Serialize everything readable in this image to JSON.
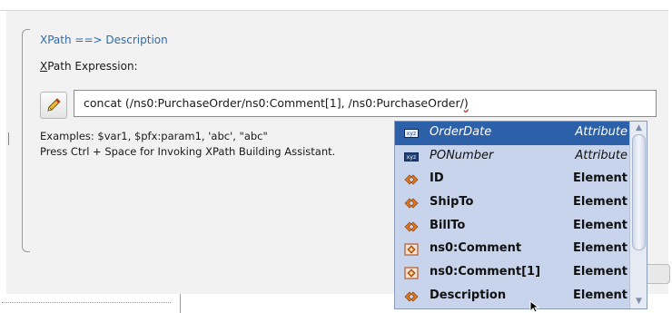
{
  "section": {
    "title": "XPath ==> Description"
  },
  "field": {
    "label_mnemonic": "X",
    "label_rest": "Path Expression:"
  },
  "input": {
    "value": "concat (/ns0:PurchaseOrder/ns0:Comment[1],  /ns0:PurchaseOrder/",
    "caret_char": ")"
  },
  "hints": {
    "examples": "Examples: $var1, $pfx:param1, 'abc', \"abc\"",
    "shortcut": "Press Ctrl + Space for Invoking XPath Building Assistant."
  },
  "autocomplete": {
    "items": [
      {
        "name": "OrderDate",
        "kind": "Attribute",
        "icon": "attribute-icon",
        "icon_text": "xyz",
        "selected": true
      },
      {
        "name": "PONumber",
        "kind": "Attribute",
        "icon": "attribute-icon",
        "icon_text": "xyz",
        "selected": false
      },
      {
        "name": "ID",
        "kind": "Element",
        "icon": "element-icon",
        "selected": false
      },
      {
        "name": "ShipTo",
        "kind": "Element",
        "icon": "element-icon",
        "selected": false
      },
      {
        "name": "BillTo",
        "kind": "Element",
        "icon": "element-icon",
        "selected": false
      },
      {
        "name": "ns0:Comment",
        "kind": "Element",
        "icon": "repeating-element-icon",
        "selected": false
      },
      {
        "name": "ns0:Comment[1]",
        "kind": "Element",
        "icon": "repeating-element-icon",
        "selected": false
      },
      {
        "name": "Description",
        "kind": "Element",
        "icon": "element-icon",
        "selected": false
      }
    ]
  },
  "colors": {
    "title_blue": "#2f6bb0",
    "selection": "#2c60a8",
    "popup_bg": "#c7d4ec",
    "element_icon": "#e07a1c",
    "repeating_icon": "#b35a2e"
  }
}
